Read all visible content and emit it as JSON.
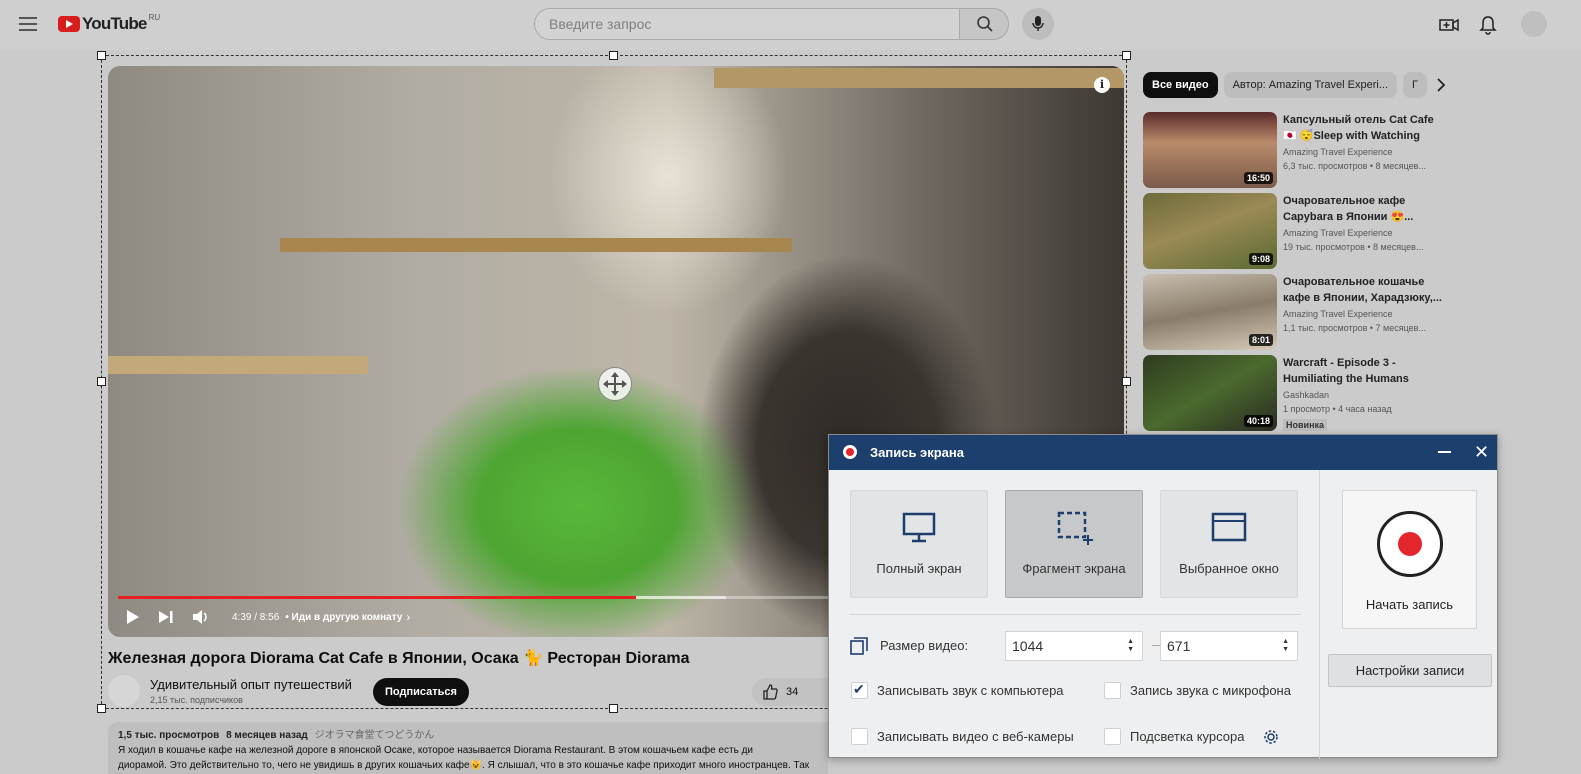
{
  "header": {
    "logo_text": "YouTube",
    "region": "RU",
    "search_placeholder": "Введите запрос"
  },
  "video": {
    "title": "Железная дорога Diorama Cat Cafe в Японии, Осака 🐈 Ресторан Diorama",
    "current_time": "4:39 / 8:56",
    "chapter": "• Иди в другую комнату",
    "progress_fraction": 0.52,
    "buffered_fraction": 0.61,
    "channel_name": "Удивительный опыт путешествий",
    "subscribers": "2,15 тыс. подписчиков",
    "subscribe_label": "Подписаться",
    "likes": "34",
    "views": "1,5 тыс. просмотров",
    "age": "8 месяцев назад",
    "tags": "ジオラマ食堂てつどうかん",
    "description_line1": "Я ходил в кошачье кафе на железной дороге в японской Осаке, которое называется Diorama Restaurant. В этом кошачьем кафе есть ди",
    "description_line2": "диорамой. Это действительно то, чего не увидишь в других кошачьих кафе😺. Я слышал, что в это кошачье кафе приходит много иностранцев. Так что это кошачье кафе довольно"
  },
  "sidebar": {
    "chips": [
      "Все видео",
      "Автор: Amazing Travel Experi...",
      "Г"
    ],
    "recommendations": [
      {
        "title": "Капсульный отель Cat Cafe🇯🇵 😴Sleep with Watching Cats,...",
        "channel": "Amazing Travel Experience",
        "meta": "6,3 тыс. просмотров • 8 месяцев...",
        "duration": "16:50",
        "badge": ""
      },
      {
        "title": "Очаровательное кафе Capybara в Японии 😍...",
        "channel": "Amazing Travel Experience",
        "meta": "19 тыс. просмотров • 8 месяцев...",
        "duration": "9:08",
        "badge": ""
      },
      {
        "title": "Очаровательное кошачье кафе в Японии, Харадзюку,...",
        "channel": "Amazing Travel Experience",
        "meta": "1,1 тыс. просмотров • 7 месяцев...",
        "duration": "8:01",
        "badge": ""
      },
      {
        "title": "Warcraft - Episode 3 - Humiliating the Humans",
        "channel": "Gashkadan",
        "meta": "1 просмотр • 4 часа назад",
        "duration": "40:18",
        "badge": "Новинка"
      }
    ]
  },
  "recorder": {
    "title": "Запись экрана",
    "modes": [
      "Полный экран",
      "Фрагмент экрана",
      "Выбранное окно"
    ],
    "active_mode": "Фрагмент экрана",
    "size_label": "Размер видео:",
    "width": "1044",
    "height": "671",
    "options": [
      {
        "label": "Записывать звук с компьютера",
        "checked": true
      },
      {
        "label": "Запись звука с микрофона",
        "checked": false
      },
      {
        "label": "Записывать видео с веб-камеры",
        "checked": false
      },
      {
        "label": "Подсветка курсора",
        "checked": false
      }
    ],
    "start_label": "Начать запись",
    "settings_label": "Настройки записи"
  },
  "colors": {
    "recorder_titlebar": "#1d3f6e",
    "record_red": "#e3262c",
    "progress_red": "#e41f1f"
  }
}
